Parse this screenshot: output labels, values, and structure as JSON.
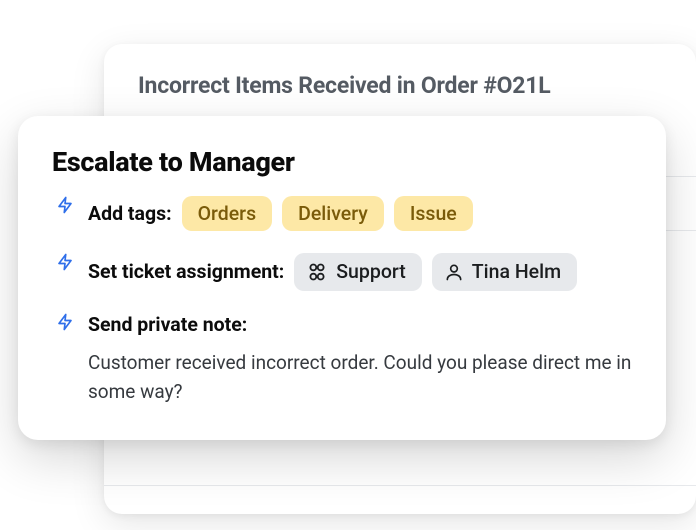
{
  "backCard": {
    "title": "Incorrect Items Received in Order #O21L"
  },
  "frontCard": {
    "title": "Escalate to Manager",
    "steps": {
      "addTags": {
        "label": "Add tags:",
        "tags": [
          "Orders",
          "Delivery",
          "Issue"
        ]
      },
      "assignment": {
        "label": "Set ticket assignment:",
        "group": "Support",
        "person": "Tina Helm"
      },
      "note": {
        "label": "Send private note:",
        "body": "Customer received incorrect order. Could you please direct me in some way?"
      }
    }
  }
}
